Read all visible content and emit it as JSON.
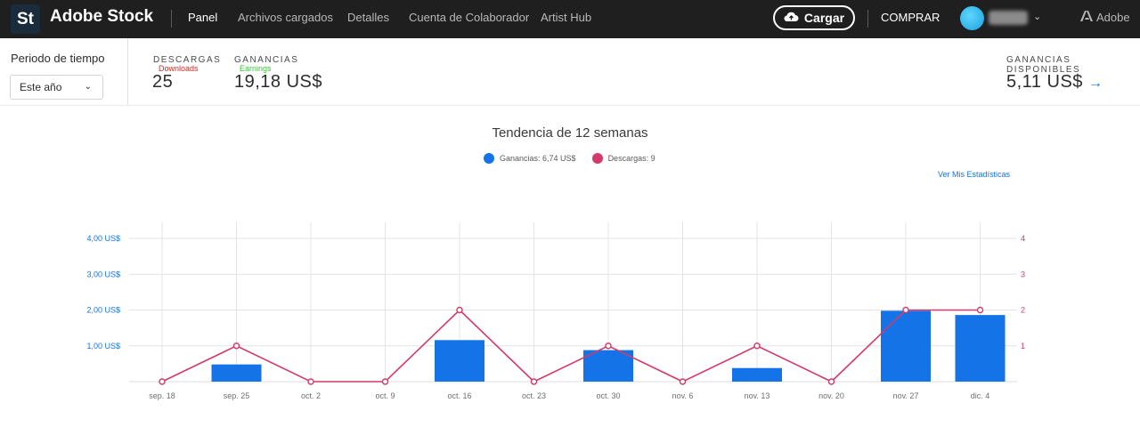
{
  "nav": {
    "logo_text": "St",
    "app_name": "Adobe Stock",
    "items": [
      {
        "label": "Panel",
        "active": true
      },
      {
        "label": "Archivos cargados",
        "active": false
      },
      {
        "label": "Detalles",
        "active": false
      },
      {
        "label": "Cuenta de Colaborador",
        "active": false
      },
      {
        "label": "Artist Hub",
        "active": false
      }
    ],
    "upload_label": "Cargar",
    "buy_label": "COMPRAR",
    "brand": "Adobe"
  },
  "filters": {
    "period_label": "Periodo de tiempo",
    "period_value": "Este año"
  },
  "stats": {
    "downloads_label": "DESCARGAS",
    "downloads_sub": "Downloads",
    "downloads_value": "25",
    "earnings_label": "GANANCIAS",
    "earnings_sub": "Earnings",
    "earnings_value": "19,18 US$",
    "available_label": "GANANCIAS DISPONIBLES",
    "available_value": "5,11 US$",
    "arrow": "→"
  },
  "chart": {
    "title": "Tendencia de 12 semanas",
    "legend_earnings": "Ganancias: 6,74 US$",
    "legend_downloads": "Descargas: 9",
    "stats_link": "Ver Mis Estadísticas"
  },
  "colors": {
    "earnings": "#1473e6",
    "downloads": "#d43a68",
    "grid": "#e4e4e4",
    "topbar": "#1f1f1f"
  },
  "chart_data": {
    "type": "bar",
    "title": "Tendencia de 12 semanas",
    "categories": [
      "sep. 18",
      "sep. 25",
      "oct. 2",
      "oct. 9",
      "oct. 16",
      "oct. 23",
      "oct. 30",
      "nov. 6",
      "nov. 13",
      "nov. 20",
      "nov. 27",
      "dic. 4"
    ],
    "series": [
      {
        "name": "Ganancias",
        "type": "bar",
        "axis": "left",
        "values": [
          0,
          0.48,
          0,
          0,
          1.16,
          0,
          0.88,
          0,
          0.38,
          0,
          1.98,
          1.86
        ]
      },
      {
        "name": "Descargas",
        "type": "line",
        "axis": "right",
        "values": [
          0,
          1,
          0,
          0,
          2,
          0,
          1,
          0,
          1,
          0,
          2,
          2
        ]
      }
    ],
    "ylim_left": [
      0,
      4
    ],
    "ylim_right": [
      0,
      4
    ],
    "left_ticks": [
      "1,00 US$",
      "2,00 US$",
      "3,00 US$",
      "4,00 US$"
    ],
    "right_ticks": [
      "1",
      "2",
      "3",
      "4"
    ],
    "grid": true,
    "legend_position": "top-center"
  }
}
